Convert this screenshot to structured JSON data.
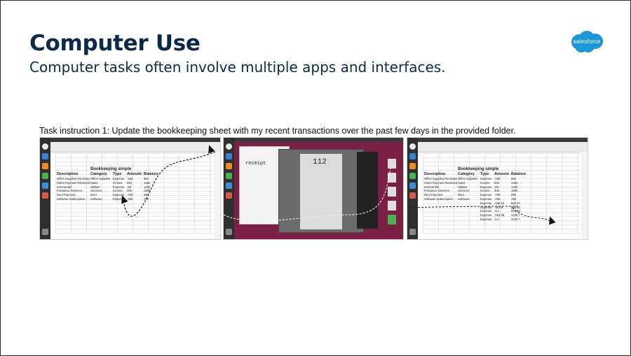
{
  "title": "Computer Use",
  "subtitle": "Computer tasks often involve multiple apps and interfaces.",
  "brand": {
    "name": "salesforce",
    "color": "#1b96d6"
  },
  "task_instruction": "Task instruction 1: Update the bookkeeping sheet with my recent transactions over the past few days in the provided folder.",
  "sheet": {
    "title": "Bookkeeping simple",
    "headers": [
      "Description",
      "Category",
      "Type",
      "Amount",
      "Balance"
    ],
    "rows": [
      [
        "Office Supplies Purchase",
        "Office Supplies",
        "Expense",
        "-150",
        "850"
      ],
      [
        "Client Payment Received",
        "Sales",
        "Income",
        "500",
        "1350"
      ],
      [
        "Internet Bill",
        "Utilities",
        "Expense",
        "-60",
        "1290"
      ],
      [
        "Freelance Services",
        "Services",
        "Income",
        "300",
        "1590"
      ],
      [
        "Rent Payment",
        "Rent",
        "Expense",
        "-700",
        "890"
      ],
      [
        "Software Subscription",
        "Software",
        "Expense",
        "-100",
        "790"
      ]
    ],
    "new_rows": [
      [
        "",
        "",
        "Expense",
        "-186.53",
        "603.07"
      ],
      [
        "",
        "",
        "Expense",
        "-36.09",
        "566.93"
      ],
      [
        "",
        "",
        "Expense",
        "-5.1",
        "561.83"
      ],
      [
        "",
        "",
        "Expense",
        "-154.06",
        "1236.?"
      ],
      [
        "",
        "",
        "Expense",
        "-8.1",
        "3234.?"
      ]
    ]
  },
  "receipt": {
    "heading": "receipt",
    "number": "112"
  }
}
